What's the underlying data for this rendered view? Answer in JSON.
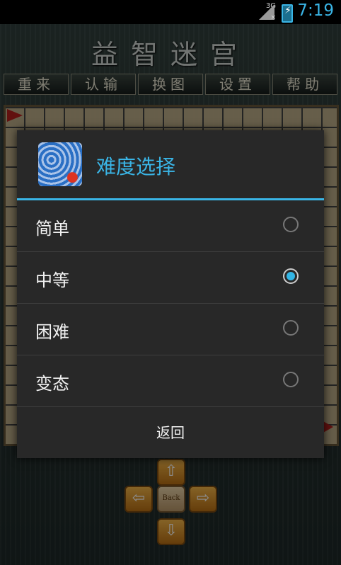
{
  "status_bar": {
    "network": "3G",
    "time": "7:19",
    "colors": {
      "accent": "#3ab5e6"
    }
  },
  "app": {
    "title": "益智迷宫",
    "toolbar": [
      "重来",
      "认输",
      "换图",
      "设置",
      "帮助"
    ],
    "dpad": {
      "up": "⇧",
      "down": "⇩",
      "left": "⇦",
      "right": "⇨",
      "center": "Back"
    }
  },
  "dialog": {
    "title": "难度选择",
    "options": [
      {
        "label": "简单",
        "checked": false
      },
      {
        "label": "中等",
        "checked": true
      },
      {
        "label": "困难",
        "checked": false
      },
      {
        "label": "变态",
        "checked": false
      }
    ],
    "back_label": "返回",
    "colors": {
      "accent": "#33b5e5",
      "background": "#282828"
    }
  }
}
